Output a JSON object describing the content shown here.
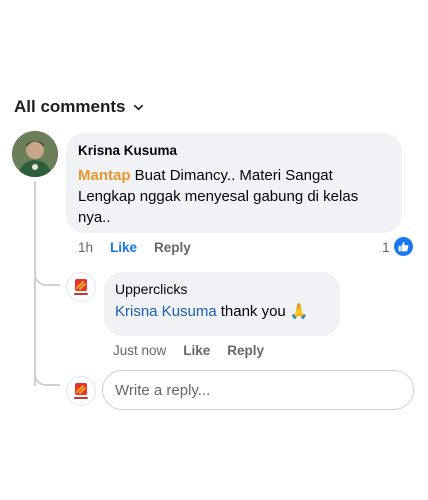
{
  "header": {
    "title": "All comments",
    "chevron_icon": "chevron-down-icon"
  },
  "comment": {
    "author": "Krisna Kusuma",
    "highlight": "Mantap",
    "text": " Buat Dimancy.. Materi Sangat Lengkap nggak menyesal gabung di kelas nya..",
    "time": "1h",
    "like_label": "Like",
    "reply_label": "Reply",
    "reaction_count": "1",
    "reaction_icon": "like-icon"
  },
  "reply": {
    "author": "Upperclicks",
    "mention": "Krisna Kusuma",
    "text": "thank you",
    "emoji": "🙏",
    "time": "Just now",
    "like_label": "Like",
    "reply_label": "Reply"
  },
  "composer": {
    "placeholder": "Write a reply..."
  },
  "colors": {
    "like_blue": "#1877f2",
    "highlight_orange": "#e8962c",
    "bubble_bg": "#f0f2f5"
  }
}
